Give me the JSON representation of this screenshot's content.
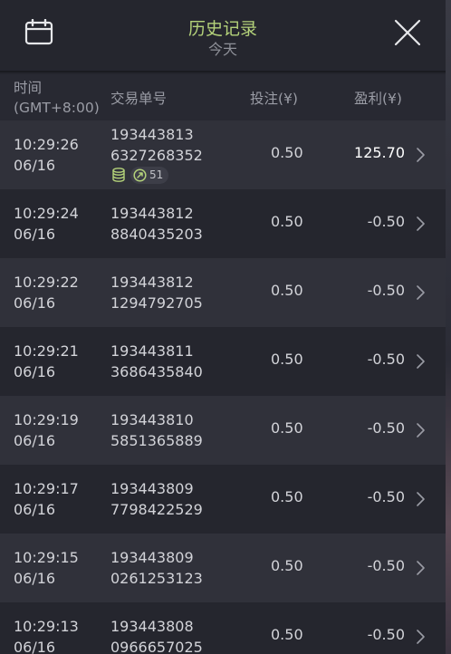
{
  "header": {
    "title": "历史记录",
    "subtitle": "今天"
  },
  "columns": {
    "time": "时间\n(GMT+8:00)",
    "order": "交易单号",
    "bet": "投注(¥)",
    "profit": "盈利(¥)"
  },
  "rows": [
    {
      "time": "10:29:26",
      "date": "06/16",
      "order1": "193443813",
      "order2": "6327268352",
      "bet": "0.50",
      "profit": "125.70",
      "win": true,
      "badge_count": "51"
    },
    {
      "time": "10:29:24",
      "date": "06/16",
      "order1": "193443812",
      "order2": "8840435203",
      "bet": "0.50",
      "profit": "-0.50"
    },
    {
      "time": "10:29:22",
      "date": "06/16",
      "order1": "193443812",
      "order2": "1294792705",
      "bet": "0.50",
      "profit": "-0.50"
    },
    {
      "time": "10:29:21",
      "date": "06/16",
      "order1": "193443811",
      "order2": "3686435840",
      "bet": "0.50",
      "profit": "-0.50"
    },
    {
      "time": "10:29:19",
      "date": "06/16",
      "order1": "193443810",
      "order2": "5851365889",
      "bet": "0.50",
      "profit": "-0.50"
    },
    {
      "time": "10:29:17",
      "date": "06/16",
      "order1": "193443809",
      "order2": "7798422529",
      "bet": "0.50",
      "profit": "-0.50"
    },
    {
      "time": "10:29:15",
      "date": "06/16",
      "order1": "193443809",
      "order2": "0261253123",
      "bet": "0.50",
      "profit": "-0.50"
    },
    {
      "time": "10:29:13",
      "date": "06/16",
      "order1": "193443808",
      "order2": "0966657025",
      "bet": "0.50",
      "profit": "-0.50"
    }
  ],
  "colors": {
    "title": "#b4d27a",
    "background": "#24252d",
    "row_alt": "#30313a"
  },
  "icons": {
    "calendar": "calendar-icon",
    "close": "close-icon",
    "chevron": "chevron-right-icon",
    "coins": "coins-icon",
    "feature": "free-spin-icon"
  }
}
